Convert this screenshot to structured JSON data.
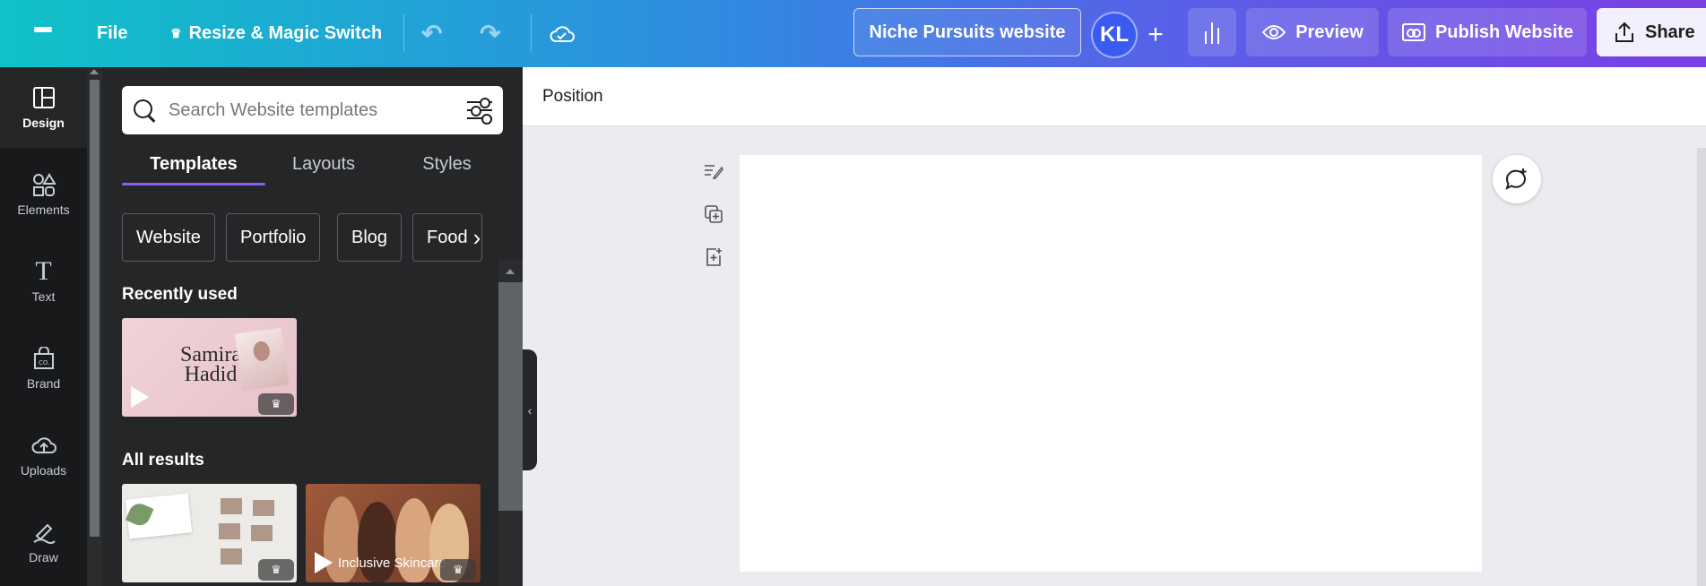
{
  "topbar": {
    "file_label": "File",
    "resize_label": "Resize & Magic Switch",
    "design_name": "Niche Pursuits website",
    "avatar_initials": "KL",
    "preview_label": "Preview",
    "publish_label": "Publish Website",
    "share_label": "Share"
  },
  "rail": {
    "items": [
      {
        "label": "Design",
        "icon": "layout-icon"
      },
      {
        "label": "Elements",
        "icon": "shapes-icon"
      },
      {
        "label": "Text",
        "icon": "text-icon"
      },
      {
        "label": "Brand",
        "icon": "brand-icon"
      },
      {
        "label": "Uploads",
        "icon": "cloud-upload-icon"
      },
      {
        "label": "Draw",
        "icon": "draw-icon"
      }
    ]
  },
  "panel": {
    "search_placeholder": "Search Website templates",
    "tabs": [
      "Templates",
      "Layouts",
      "Styles"
    ],
    "chips": [
      "Website",
      "Portfolio",
      "Blog",
      "Food"
    ],
    "recently_used_title": "Recently used",
    "all_results_title": "All results",
    "recent_template_name_line1": "Samira",
    "recent_template_name_line2": "Hadid",
    "result_template_label": "Inclusive Skincare"
  },
  "context_bar": {
    "position_label": "Position"
  },
  "colors": {
    "accent": "#8b5cf6",
    "topbar_start": "#0fc2c8",
    "topbar_end": "#7b3fe4"
  }
}
